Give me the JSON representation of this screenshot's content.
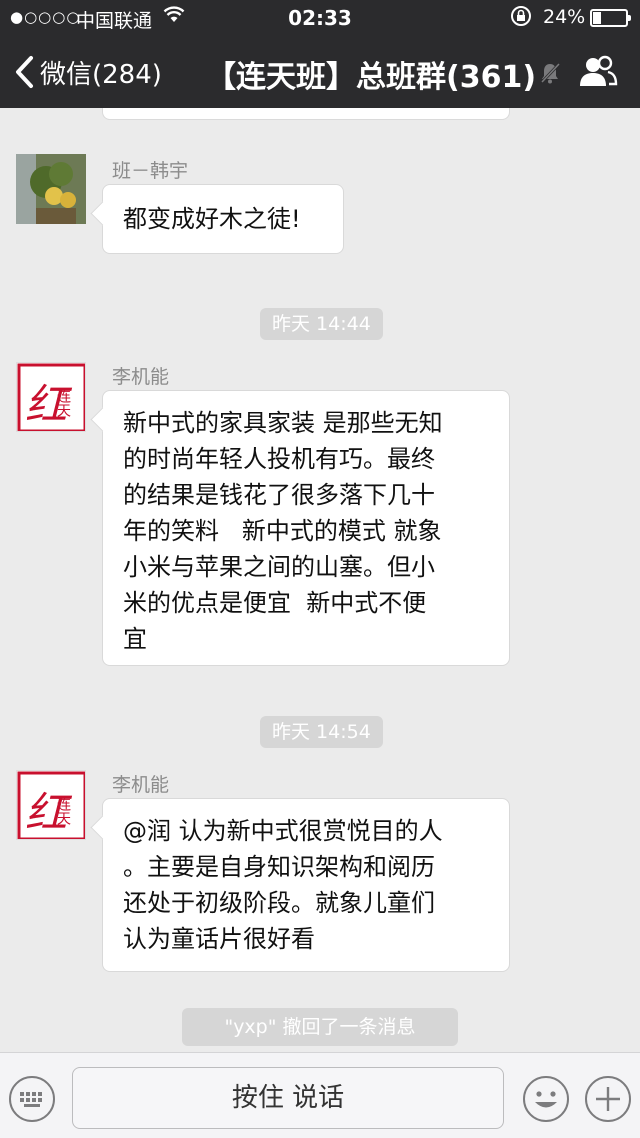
{
  "status_bar": {
    "signal": "●○○○○",
    "carrier": "中国联通",
    "time": "02:33",
    "battery_percent": "24%",
    "battery_level": 0.24
  },
  "nav": {
    "back_label": "微信(284)",
    "title": "【连天班】总班群(361)"
  },
  "messages": [
    {
      "sender": "班－韩宇",
      "text": "都变成好木之徒!"
    },
    {
      "timestamp": "昨天 14:44"
    },
    {
      "sender": "李机能",
      "lines": [
        "新中式的家具家装 是那些无知",
        "的时尚年轻人投机有巧。最终",
        "的结果是钱花了很多落下几十",
        "年的笑料   新中式的模式 就象",
        "小米与苹果之间的山塞。但小",
        "米的优点是便宜  新中式不便",
        "宜"
      ]
    },
    {
      "timestamp": "昨天 14:54"
    },
    {
      "sender": "李机能",
      "lines": [
        "@润 认为新中式很赏悦目的人",
        "。主要是自身知识架构和阅历",
        "还处于初级阶段。就象儿童们",
        "认为童话片很好看"
      ]
    },
    {
      "system": "\"yxp\" 撤回了一条消息"
    }
  ],
  "avatar_text": {
    "main": "红",
    "side": "连天"
  },
  "input_bar": {
    "hold_to_talk": "按住 说话"
  },
  "colors": {
    "header_bg": "#2b2b2d",
    "chat_bg": "#ebebeb",
    "bubble_bg": "#ffffff",
    "avatar_red": "#c8102e"
  }
}
